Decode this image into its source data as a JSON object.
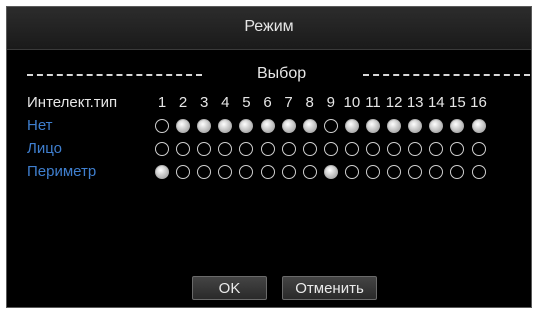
{
  "dialog": {
    "title": "Режим"
  },
  "section": {
    "title": "Выбор"
  },
  "grid": {
    "header_label": "Интелект.тип",
    "channels": [
      "1",
      "2",
      "3",
      "4",
      "5",
      "6",
      "7",
      "8",
      "9",
      "10",
      "11",
      "12",
      "13",
      "14",
      "15",
      "16"
    ],
    "rows": [
      {
        "label": "Нет",
        "selected": [
          false,
          true,
          true,
          true,
          true,
          true,
          true,
          true,
          false,
          true,
          true,
          true,
          true,
          true,
          true,
          true
        ]
      },
      {
        "label": "Лицо",
        "selected": [
          false,
          false,
          false,
          false,
          false,
          false,
          false,
          false,
          false,
          false,
          false,
          false,
          false,
          false,
          false,
          false
        ]
      },
      {
        "label": "Периметр",
        "selected": [
          true,
          false,
          false,
          false,
          false,
          false,
          false,
          false,
          true,
          false,
          false,
          false,
          false,
          false,
          false,
          false
        ]
      }
    ]
  },
  "buttons": {
    "ok": "OK",
    "cancel": "Отменить"
  },
  "colors": {
    "mode_label": "#3f7fcf",
    "background": "#000000"
  }
}
